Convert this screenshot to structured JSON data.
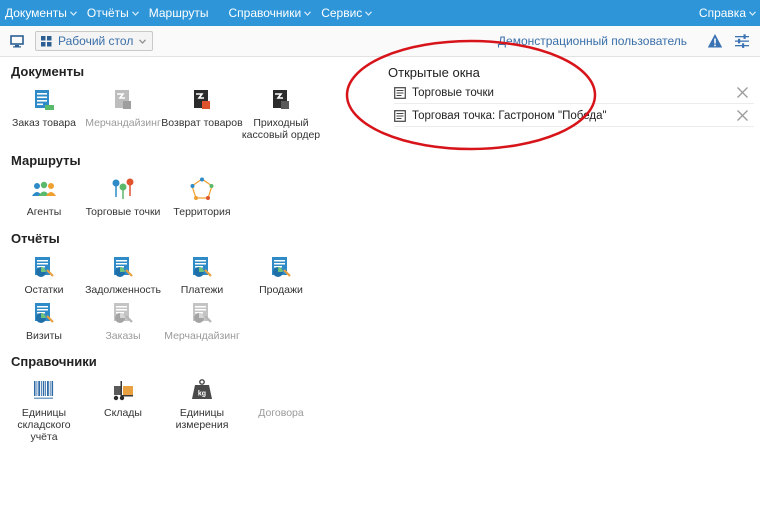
{
  "menu": {
    "items": [
      {
        "label": "Документы",
        "has_chevron": true
      },
      {
        "label": "Отчёты",
        "has_chevron": true
      },
      {
        "label": "Маршруты",
        "has_chevron": false
      },
      {
        "label": "Справочники",
        "has_chevron": true
      },
      {
        "label": "Сервис",
        "has_chevron": true
      }
    ],
    "help": {
      "label": "Справка",
      "has_chevron": true
    },
    "bg_color": "#2e96d8"
  },
  "toolbar": {
    "desktop_label": "Рабочий стол",
    "user_label": "Демонстрационный пользователь",
    "icons": [
      "monitor-icon",
      "grid-icon",
      "warning-icon",
      "sliders-icon"
    ]
  },
  "sections": {
    "documents": {
      "title": "Документы",
      "items": [
        {
          "label": "Заказ товара",
          "enabled": true,
          "icon": "order-icon"
        },
        {
          "label": "Мерчандайзинг",
          "enabled": false,
          "icon": "merch-icon"
        },
        {
          "label": "Возврат товаров",
          "enabled": true,
          "icon": "return-icon"
        },
        {
          "label": "Приходный кассовый ордер",
          "enabled": true,
          "icon": "cash-order-icon"
        }
      ]
    },
    "routes": {
      "title": "Маршруты",
      "items": [
        {
          "label": "Агенты",
          "enabled": true,
          "icon": "agents-icon"
        },
        {
          "label": "Торговые точки",
          "enabled": true,
          "icon": "map-pins-icon"
        },
        {
          "label": "Территория",
          "enabled": true,
          "icon": "polygon-icon"
        }
      ]
    },
    "reports": {
      "title": "Отчёты",
      "items": [
        {
          "label": "Остатки",
          "enabled": true,
          "icon": "report-icon"
        },
        {
          "label": "Задолженность",
          "enabled": true,
          "icon": "report-icon"
        },
        {
          "label": "Платежи",
          "enabled": true,
          "icon": "report-icon"
        },
        {
          "label": "Продажи",
          "enabled": true,
          "icon": "report-icon"
        },
        {
          "label": "Визиты",
          "enabled": true,
          "icon": "report-icon"
        },
        {
          "label": "Заказы",
          "enabled": false,
          "icon": "report-icon"
        },
        {
          "label": "Мерчандайзинг",
          "enabled": false,
          "icon": "report-icon"
        }
      ]
    },
    "directories": {
      "title": "Справочники",
      "items": [
        {
          "label": "Единицы складского учёта",
          "enabled": true,
          "icon": "barcode-icon"
        },
        {
          "label": "Склады",
          "enabled": true,
          "icon": "forklift-icon"
        },
        {
          "label": "Единицы измерения",
          "enabled": true,
          "icon": "weight-icon"
        },
        {
          "label": "Договора",
          "enabled": false,
          "icon": "contract-icon"
        }
      ]
    }
  },
  "open_windows": {
    "title": "Открытые окна",
    "items": [
      {
        "label": "Торговые точки"
      },
      {
        "label": "Торговая точка: Гастроном \"Победа\""
      }
    ]
  },
  "colors": {
    "accent": "#2e96d8",
    "link": "#3a6fa8",
    "highlight_ellipse": "#d7141a"
  }
}
